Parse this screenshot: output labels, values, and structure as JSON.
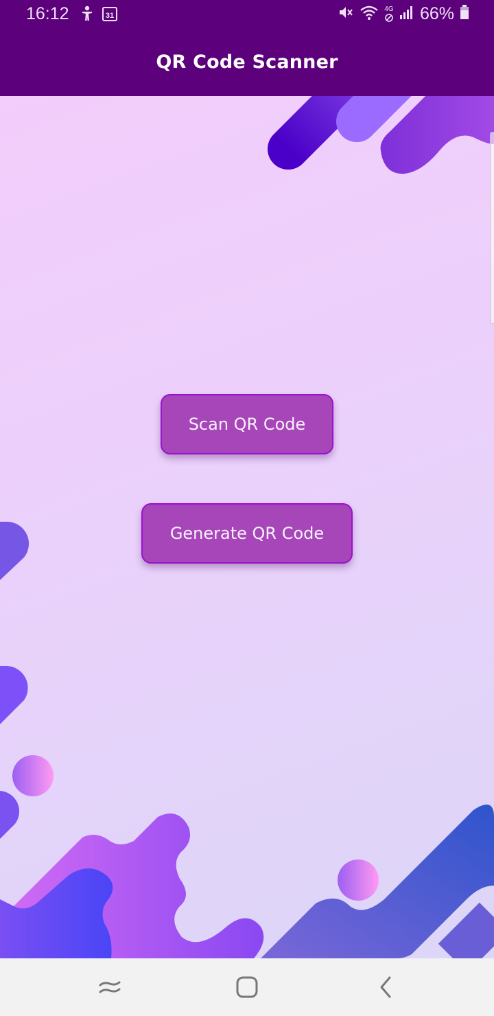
{
  "status_bar": {
    "time": "16:12",
    "battery": "66%",
    "network": "4G",
    "icons": [
      "accessibility-icon",
      "calendar-icon",
      "mute-icon",
      "wifi-icon",
      "no-data-icon",
      "signal-icon",
      "battery-icon"
    ]
  },
  "app_bar": {
    "title": "QR Code Scanner",
    "color": "#5c007b"
  },
  "main": {
    "scan_button_label": "Scan QR Code",
    "generate_button_label": "Generate QR Code",
    "button_color": "#a646b8"
  },
  "nav_bar": {
    "icons": [
      "recent-apps-icon",
      "home-icon",
      "back-icon"
    ]
  }
}
